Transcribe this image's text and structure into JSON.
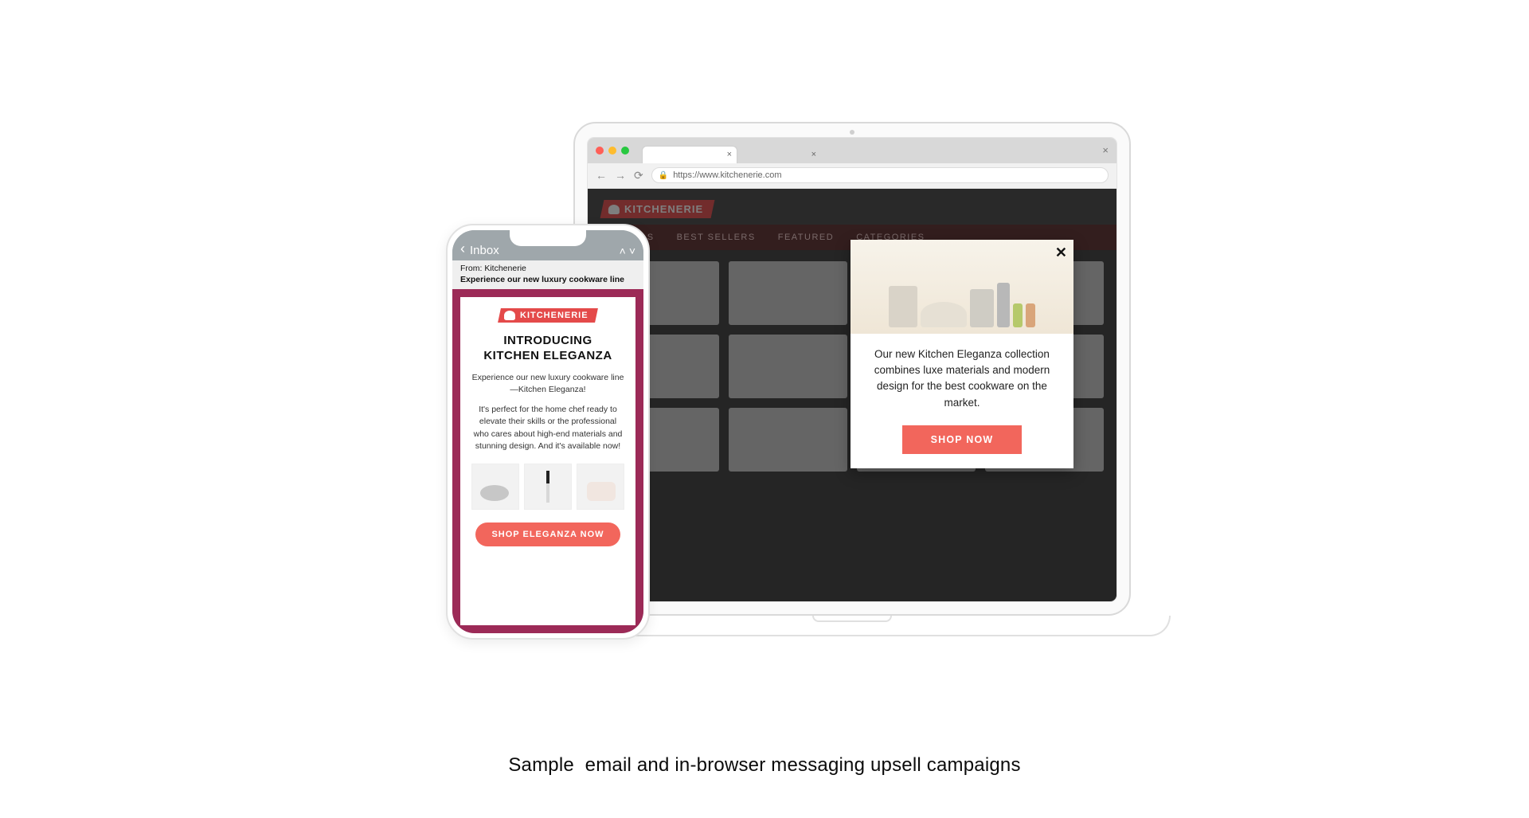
{
  "caption": "Sample  email and in-browser messaging upsell campaigns",
  "brand": {
    "name": "KITCHENERIE"
  },
  "browser": {
    "url": "https://www.kitchenerie.com"
  },
  "site": {
    "nav": {
      "arrivals": "ARRIVALS",
      "best_sellers": "BEST SELLERS",
      "featured": "FEATURED",
      "categories": "CATEGORIES"
    }
  },
  "popup": {
    "text": "Our new Kitchen Eleganza collection combines luxe materials and modern design for the best cookware on the market.",
    "cta": "SHOP NOW"
  },
  "email": {
    "inbox_label": "Inbox",
    "from_line": "From: Kitchenerie",
    "subject": "Experience our new luxury cookware line",
    "heading_line1": "INTRODUCING",
    "heading_line2": "KITCHEN ELEGANZA",
    "intro": "Experience our new luxury cookware line—Kitchen Eleganza!",
    "copy": "It's perfect for the home chef ready to elevate their skills or the professional who cares about high-end materials and stunning design. And it's available now!",
    "cta": "SHOP ELEGANZA NOW"
  }
}
